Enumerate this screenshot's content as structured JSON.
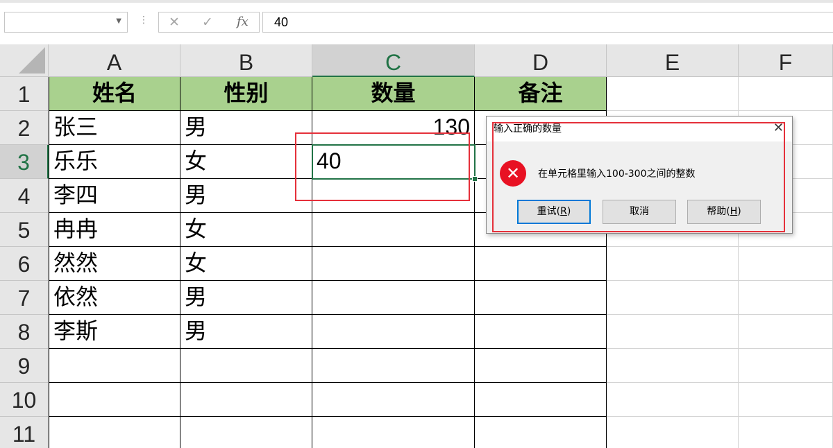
{
  "formula_bar": {
    "name_box": "",
    "cancel_symbol": "✕",
    "confirm_symbol": "✓",
    "fx_label": "fx",
    "content": "40"
  },
  "columns": [
    "A",
    "B",
    "C",
    "D",
    "E",
    "F"
  ],
  "rows": [
    "1",
    "2",
    "3",
    "4",
    "5",
    "6",
    "7",
    "8",
    "9",
    "10",
    "11"
  ],
  "table": {
    "headers": [
      "姓名",
      "性别",
      "数量",
      "备注"
    ],
    "rows": [
      {
        "name": "张三",
        "gender": "男",
        "qty": "130"
      },
      {
        "name": "乐乐",
        "gender": "女",
        "qty": "40"
      },
      {
        "name": "李四",
        "gender": "男",
        "qty": ""
      },
      {
        "name": "冉冉",
        "gender": "女",
        "qty": ""
      },
      {
        "name": "然然",
        "gender": "女",
        "qty": ""
      },
      {
        "name": "依然",
        "gender": "男",
        "qty": ""
      },
      {
        "name": "李斯",
        "gender": "男",
        "qty": ""
      }
    ]
  },
  "dialog": {
    "title": "输入正确的数量",
    "close_symbol": "✕",
    "icon": "error-icon",
    "icon_symbol": "✕",
    "message": "在单元格里输入100-300之间的整数",
    "buttons": [
      {
        "label": "重试(",
        "key": "R",
        "suffix": ")"
      },
      {
        "label": "取消",
        "key": "",
        "suffix": ""
      },
      {
        "label": "帮助(",
        "key": "H",
        "suffix": ")"
      }
    ]
  },
  "colors": {
    "header_fill": "#a9d18e",
    "accent_green": "#217346",
    "annotation_red": "#e5303a",
    "error_red": "#e81123"
  }
}
